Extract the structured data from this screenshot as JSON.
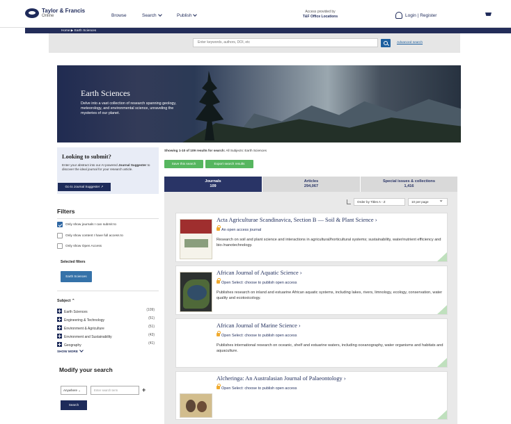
{
  "header": {
    "brand": "Taylor & Francis",
    "brand_sub": "Online",
    "nav": [
      "Browse",
      "Search",
      "Publish"
    ],
    "access_line1": "Access provided by",
    "access_line2": "T&F Office Locations",
    "login": "Login | Register"
  },
  "breadcrumb": "Home  ▶  Earth Sciences",
  "search": {
    "placeholder": "Enter keywords, authors, DOI, etc",
    "advanced": "Advanced search"
  },
  "hero": {
    "title": "Earth Sciences",
    "description": "Delve into a vast collection of research spanning geology, meteorology, and environmental science, unraveling the mysteries of our planet."
  },
  "submit": {
    "title": "Looking to submit?",
    "text_before": "Enter your abstract into our AI powered ",
    "text_bold": "Journal Suggester",
    "text_after": " to discover the ideal journal for your research article.",
    "button": "Go to Journal Suggester ↗"
  },
  "results": {
    "count_prefix": "Showing 1-10 of 109 results for search:",
    "count_suffix": " All Subjects: Earth Sciences",
    "save": "Save this search",
    "export": "Export search results"
  },
  "tabs": [
    {
      "label": "Journals",
      "count": "109"
    },
    {
      "label": "Articles",
      "count": "294,067"
    },
    {
      "label": "Special issues & collections",
      "count": "1,416"
    }
  ],
  "sort": {
    "order": "Order by Titles A - Z",
    "per_page": "10 per page"
  },
  "cards": [
    {
      "title": "Acta Agriculturae Scandinavica, Section B — Soil & Plant Science",
      "access": "An open access journal",
      "description": "Research on soil and plant science and interactions in agricultural/horticultural systems; sustainability, water/nutrient efficiency and bio-/nanotechnology."
    },
    {
      "title": "African Journal of Aquatic Science",
      "access": "Open Select: choose to publish open access",
      "description": "Publishes research on inland and estuarine African aquatic systems, including lakes, rivers, limnology, ecology, conservation, water quality and ecotoxicology."
    },
    {
      "title": "African Journal of Marine Science",
      "access": "Open Select: choose to publish open access",
      "description": "Publishes international research on oceanic, shelf and estuarine waters, including oceanography, water organisms and habitats and aquaculture."
    },
    {
      "title": "Alcheringa: An Australasian Journal of Palaeontology",
      "access": "Open Select: choose to publish open access",
      "description": ""
    }
  ],
  "filters": {
    "title": "Filters",
    "options": [
      "Only show journals I can submit to",
      "Only show content I have full access to",
      "Only show Open Access"
    ],
    "selected_title": "Selected filters",
    "selected_chip": "Earth Sciences"
  },
  "subject": {
    "title": "Subject",
    "items": [
      {
        "label": "Earth Sciences",
        "count": "(109)"
      },
      {
        "label": "Engineering & Technology",
        "count": "(51)"
      },
      {
        "label": "Environment & Agriculture",
        "count": "(51)"
      },
      {
        "label": "Environment and Sustainability",
        "count": "(43)"
      },
      {
        "label": "Geography",
        "count": "(41)"
      }
    ],
    "show_more": "SHOW MORE"
  },
  "modify": {
    "title": "Modify your search",
    "field": "Anywhere",
    "term_placeholder": "Enter search term",
    "button": "Search"
  }
}
